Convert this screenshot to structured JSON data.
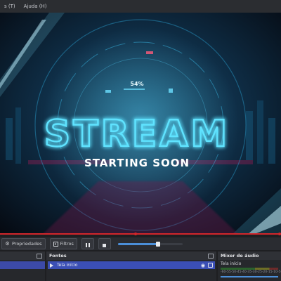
{
  "menu": {
    "items": [
      "s (T)",
      "Ajuda (H)"
    ]
  },
  "preview": {
    "title": "STREAM",
    "subtitle": "STARTING SOON",
    "percent": "54%"
  },
  "toolbar": {
    "properties_label": "Propriedades",
    "filters_label": "Filtros",
    "seek_fraction": 0.62
  },
  "sources": {
    "title": "Fontes",
    "items": [
      {
        "label": "Tela início"
      }
    ]
  },
  "mixer": {
    "title": "Mixer de áudio",
    "channel": "Tela início",
    "ticks": [
      "-60",
      "-55",
      "-50",
      "-45",
      "-40",
      "-35",
      "-30",
      "-25",
      "-20",
      "-15",
      "-10",
      "-5",
      "0"
    ]
  },
  "colors": {
    "accent": "#4b8fd9",
    "selection": "#3b4fb5",
    "red": "#d3262b",
    "neon": "#52e1ff"
  }
}
